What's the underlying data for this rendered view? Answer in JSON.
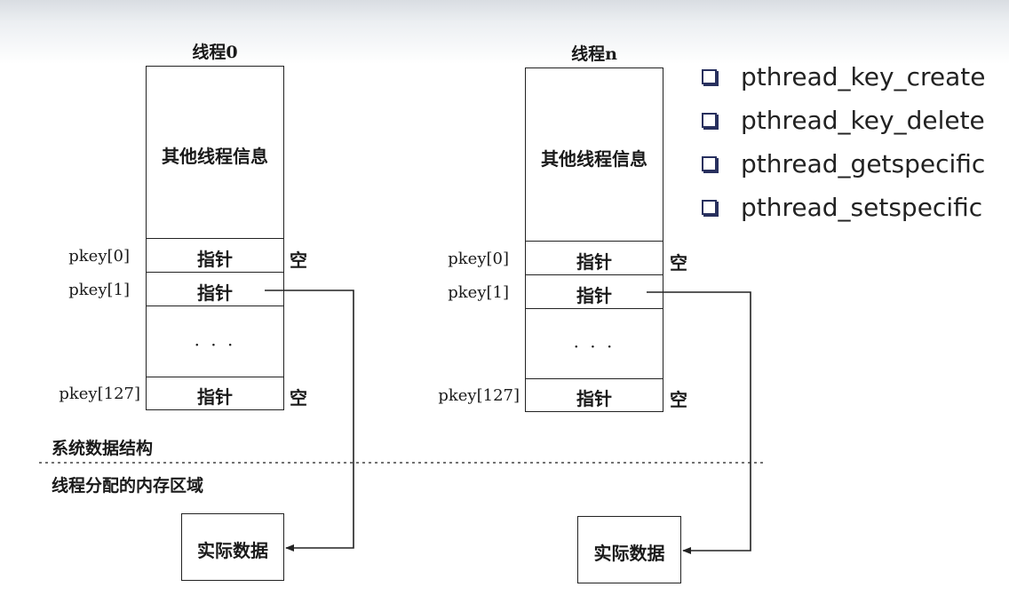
{
  "threads": [
    {
      "title": "线程0",
      "info_label": "其他线程信息",
      "rows": [
        {
          "key": "pkey[0]",
          "value": "指针",
          "note": "空"
        },
        {
          "key": "pkey[1]",
          "value": "指针",
          "note": ""
        },
        {
          "key": "",
          "value": "· · ·",
          "note": ""
        },
        {
          "key": "pkey[127]",
          "value": "指针",
          "note": "空"
        }
      ],
      "data_box": "实际数据"
    },
    {
      "title": "线程n",
      "info_label": "其他线程信息",
      "rows": [
        {
          "key": "pkey[0]",
          "value": "指针",
          "note": "空"
        },
        {
          "key": "pkey[1]",
          "value": "指针",
          "note": ""
        },
        {
          "key": "",
          "value": "· · ·",
          "note": ""
        },
        {
          "key": "pkey[127]",
          "value": "指针",
          "note": "空"
        }
      ],
      "data_box": "实际数据"
    }
  ],
  "sections": {
    "system": "系统数据结构",
    "thread_memory": "线程分配的内存区域"
  },
  "api_functions": [
    "pthread_key_create",
    "pthread_key_delete",
    "pthread_getspecific",
    "pthread_setspecific"
  ],
  "colors": {
    "bullet": "#28305e",
    "line": "#222222",
    "header_band": "#d9dde2"
  }
}
